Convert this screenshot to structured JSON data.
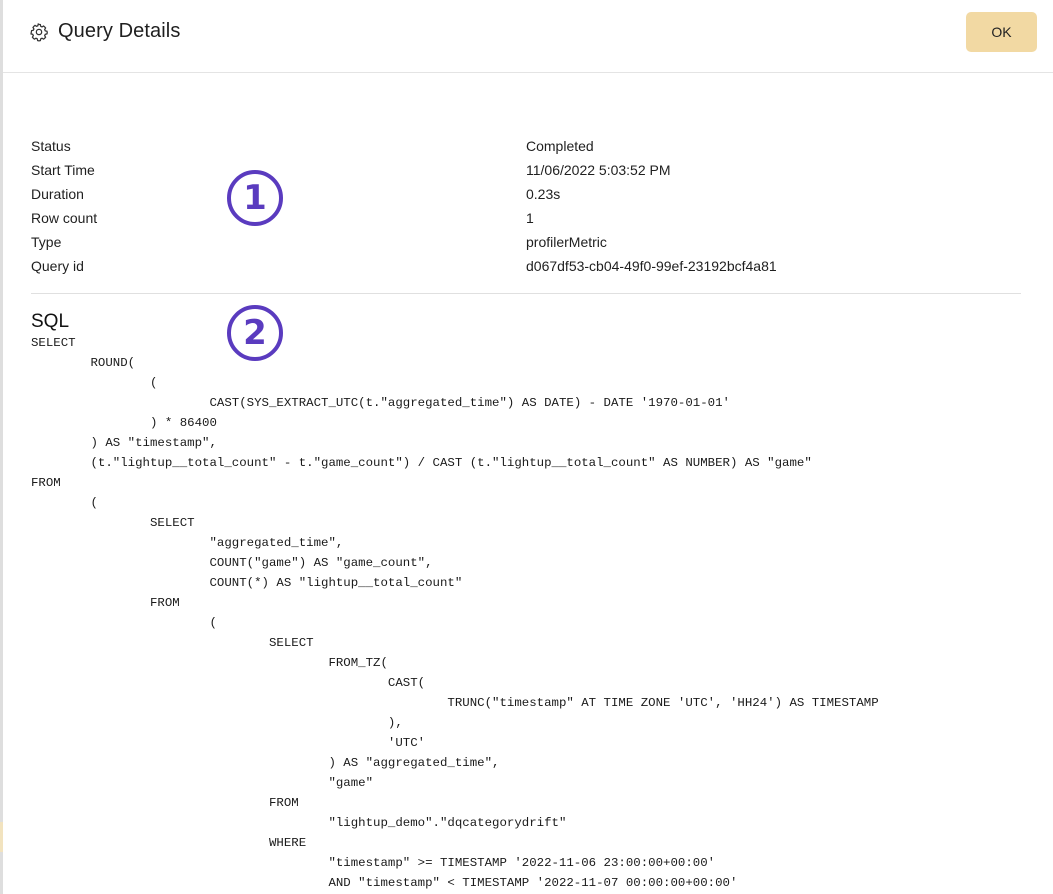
{
  "header": {
    "title": "Query Details",
    "icon": "gear-icon",
    "ok_label": "OK"
  },
  "details": [
    {
      "label": "Status",
      "value": "Completed"
    },
    {
      "label": "Start Time",
      "value": "11/06/2022 5:03:52 PM"
    },
    {
      "label": "Duration",
      "value": "0.23s"
    },
    {
      "label": "Row count",
      "value": "1"
    },
    {
      "label": "Type",
      "value": "profilerMetric"
    },
    {
      "label": "Query id",
      "value": "d067df53-cb04-49f0-99ef-23192bcf4a81"
    }
  ],
  "markers": {
    "first": "1",
    "second": "2"
  },
  "sql": {
    "title": "SQL",
    "text": "SELECT\n\tROUND(\n\t\t(\n\t\t\tCAST(SYS_EXTRACT_UTC(t.\"aggregated_time\") AS DATE) - DATE '1970-01-01'\n\t\t) * 86400\n\t) AS \"timestamp\",\n\t(t.\"lightup__total_count\" - t.\"game_count\") / CAST (t.\"lightup__total_count\" AS NUMBER) AS \"game\"\nFROM\n\t(\n\t\tSELECT\n\t\t\t\"aggregated_time\",\n\t\t\tCOUNT(\"game\") AS \"game_count\",\n\t\t\tCOUNT(*) AS \"lightup__total_count\"\n\t\tFROM\n\t\t\t(\n\t\t\t\tSELECT\n\t\t\t\t\tFROM_TZ(\n\t\t\t\t\t\tCAST(\n\t\t\t\t\t\t\tTRUNC(\"timestamp\" AT TIME ZONE 'UTC', 'HH24') AS TIMESTAMP\n\t\t\t\t\t\t),\n\t\t\t\t\t\t'UTC'\n\t\t\t\t\t) AS \"aggregated_time\",\n\t\t\t\t\t\"game\"\n\t\t\t\tFROM\n\t\t\t\t\t\"lightup_demo\".\"dqcategorydrift\"\n\t\t\t\tWHERE\n\t\t\t\t\t\"timestamp\" >= TIMESTAMP '2022-11-06 23:00:00+00:00'\n\t\t\t\t\tAND \"timestamp\" < TIMESTAMP '2022-11-07 00:00:00+00:00'"
  }
}
